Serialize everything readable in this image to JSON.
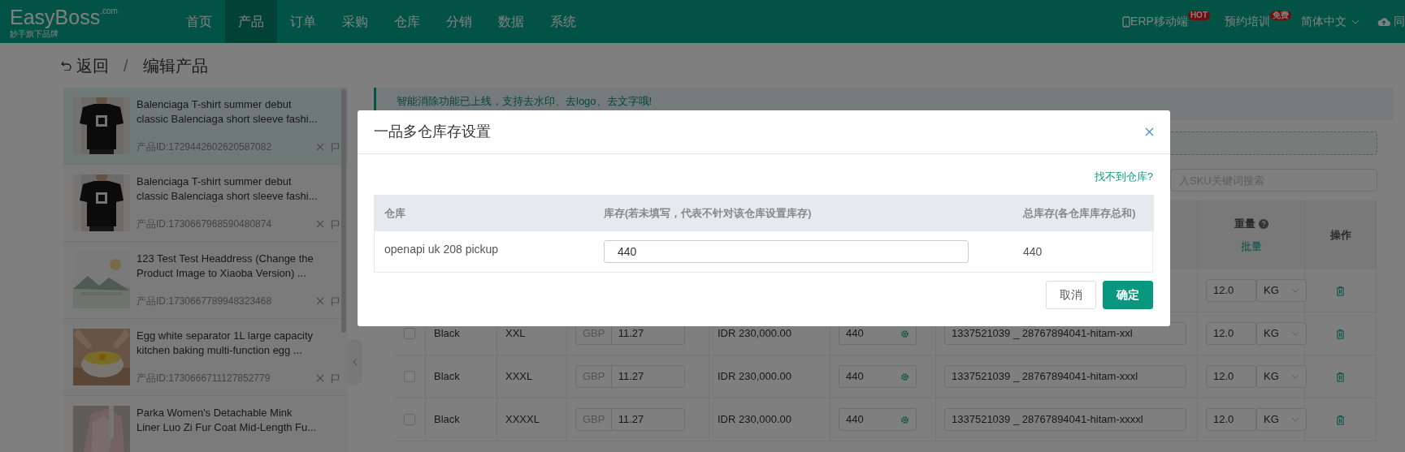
{
  "nav": {
    "logo": "EasyBoss",
    "logo_suffix": ".com",
    "tagline": "妙手旗下品牌",
    "menu": [
      {
        "label": "首页",
        "selected": false
      },
      {
        "label": "产品",
        "selected": true
      },
      {
        "label": "订单",
        "selected": false
      },
      {
        "label": "采购",
        "selected": false
      },
      {
        "label": "仓库",
        "selected": false
      },
      {
        "label": "分销",
        "selected": false
      },
      {
        "label": "数据",
        "selected": false
      },
      {
        "label": "系统",
        "selected": false
      }
    ],
    "right": [
      {
        "kind": "phone",
        "label": "ERP移动端",
        "tag": "HOT"
      },
      {
        "kind": "plain",
        "label": "预约培训",
        "tag": "免费"
      },
      {
        "kind": "dropdown",
        "label": "简体中文"
      },
      {
        "kind": "cloud",
        "label": "同"
      }
    ]
  },
  "breadcrumb": {
    "back": "返回",
    "separator": "/",
    "current": "编辑产品"
  },
  "products": [
    {
      "title_lines": [
        "Balenciaga T-shirt summer debut",
        "classic Balenciaga short sleeve fashi..."
      ],
      "id": "产品ID:1729442602620587082",
      "selected": true,
      "kind": "picture"
    },
    {
      "title_lines": [
        "Balenciaga T-shirt summer debut",
        "classic Balenciaga short sleeve fashi..."
      ],
      "id": "产品ID:1730667968590480874",
      "selected": false,
      "kind": "picture"
    },
    {
      "title_lines": [
        "123 Test Test Headdress (Change the",
        "Product Image to Xiaoba Version) ..."
      ],
      "id": "产品ID:1730667789948323468",
      "selected": false,
      "kind": "picture"
    },
    {
      "title_lines": [
        "Egg white separator 1L large capacity",
        "kitchen baking multi-function egg ..."
      ],
      "id": "产品ID:1730666711127852779",
      "selected": false,
      "kind": "picture"
    },
    {
      "title_lines": [
        "Parka Women's Detachable Mink",
        "Liner Luo Zi Fur Coat Mid-Length Fu..."
      ],
      "selected": false,
      "kind": "picture"
    }
  ],
  "notice": "智能消除功能已上线，支持去水印、去logo、去文字哦!",
  "search": {
    "placeholder": "入SKU关键词搜索"
  },
  "table": {
    "weight_header": "重量",
    "weight_batch": "批量",
    "action_header": "操作",
    "top_row": {
      "weight": "12.0",
      "unit": "KG"
    },
    "rows": [
      {
        "checked": false,
        "color_name": "Black",
        "size": "XXL",
        "currency": "GBP",
        "price": "11.27",
        "local_price": "IDR 230,000.00",
        "stock": "440",
        "sku": "1337521039 _ 28767894041-hitam-xxl",
        "weight": "12.0",
        "unit": "KG"
      },
      {
        "checked": false,
        "color_name": "Black",
        "size": "XXXL",
        "currency": "GBP",
        "price": "11.27",
        "local_price": "IDR 230,000.00",
        "stock": "440",
        "sku": "1337521039 _ 28767894041-hitam-xxxl",
        "weight": "12.0",
        "unit": "KG"
      },
      {
        "checked": false,
        "color_name": "Black",
        "size": "XXXXL",
        "currency": "GBP",
        "price": "11.27",
        "local_price": "IDR 230,000.00",
        "stock": "440",
        "sku": "1337521039 _ 28767894041-hitam-xxxxl",
        "weight": "12.0",
        "unit": "KG"
      }
    ]
  },
  "modal": {
    "title": "一品多仓库存设置",
    "find_link": "找不到仓库?",
    "columns": [
      "仓库",
      "库存(若未填写，代表不针对该仓库设置库存)",
      "总库存(各仓库库存总和)"
    ],
    "rows": [
      {
        "warehouse": "openapi uk 208 pickup",
        "stock": "440",
        "total": "440"
      }
    ],
    "buttons": [
      {
        "label": "取消",
        "kind": "secondary"
      },
      {
        "label": "确定",
        "kind": "primary"
      }
    ]
  }
}
